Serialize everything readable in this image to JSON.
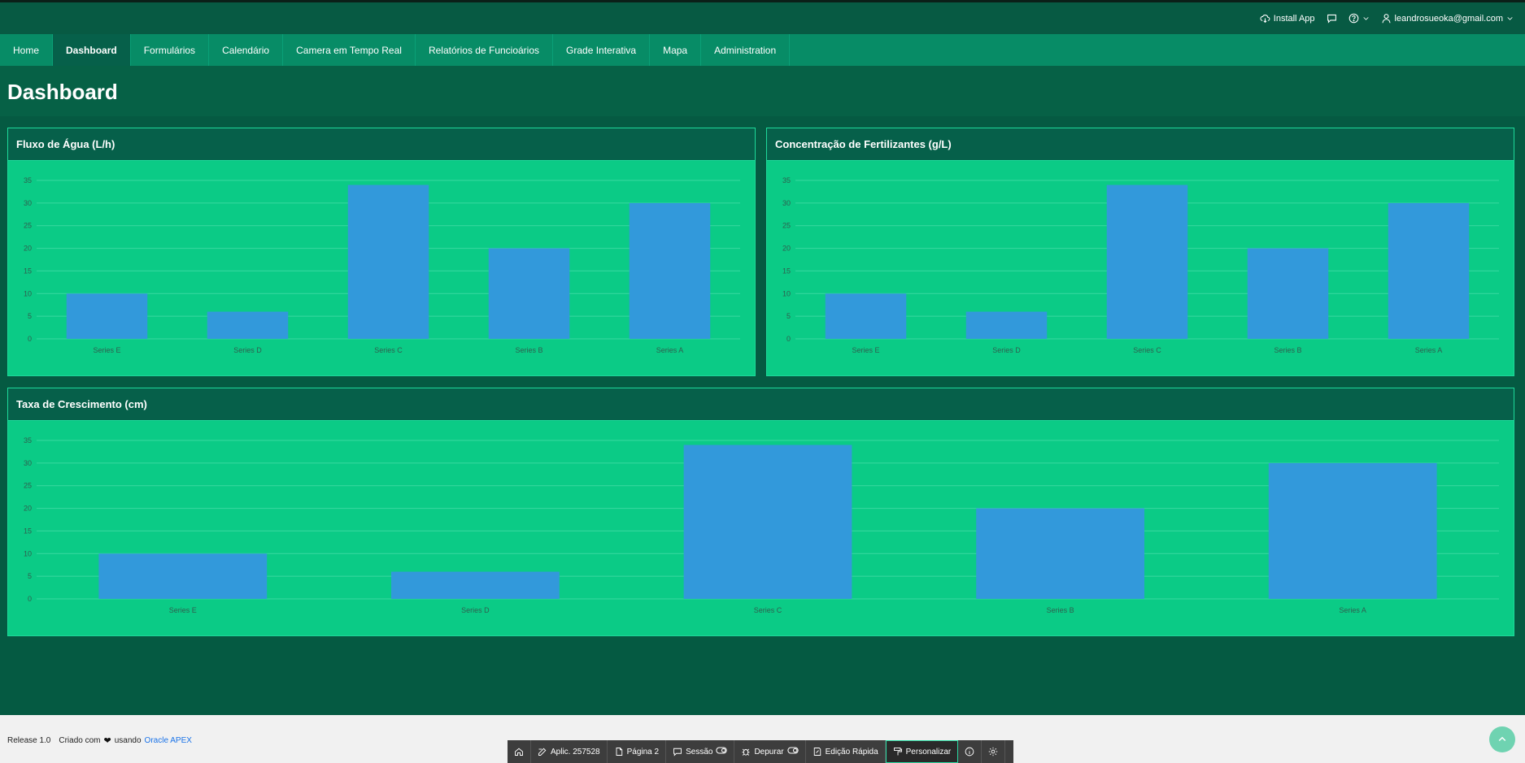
{
  "header": {
    "install_app": "Install App",
    "user_email": "leandrosueoka@gmail.com"
  },
  "nav": {
    "items": [
      {
        "label": "Home",
        "active": false
      },
      {
        "label": "Dashboard",
        "active": true
      },
      {
        "label": "Formulários",
        "active": false
      },
      {
        "label": "Calendário",
        "active": false
      },
      {
        "label": "Camera em Tempo Real",
        "active": false
      },
      {
        "label": "Relatórios de Funcioários",
        "active": false
      },
      {
        "label": "Grade Interativa",
        "active": false
      },
      {
        "label": "Mapa",
        "active": false
      },
      {
        "label": "Administration",
        "active": false
      }
    ]
  },
  "page": {
    "title": "Dashboard"
  },
  "colors": {
    "bar": "#3299db",
    "chart_bg": "#0bcb86",
    "grid": "#3ad9a0",
    "axis_text": "#2f5f4f"
  },
  "chart_data": [
    {
      "type": "bar",
      "title": "Fluxo de Água (L/h)",
      "categories": [
        "Series E",
        "Series D",
        "Series C",
        "Series B",
        "Series A"
      ],
      "values": [
        10,
        6,
        34,
        20,
        30
      ],
      "ylim": [
        0,
        35
      ],
      "yticks": [
        0,
        5,
        10,
        15,
        20,
        25,
        30,
        35
      ],
      "grid": true
    },
    {
      "type": "bar",
      "title": "Concentração de Fertilizantes (g/L)",
      "categories": [
        "Series E",
        "Series D",
        "Series C",
        "Series B",
        "Series A"
      ],
      "values": [
        10,
        6,
        34,
        20,
        30
      ],
      "ylim": [
        0,
        35
      ],
      "yticks": [
        0,
        5,
        10,
        15,
        20,
        25,
        30,
        35
      ],
      "grid": true
    },
    {
      "type": "bar",
      "title": "Taxa de Crescimento (cm)",
      "categories": [
        "Series E",
        "Series D",
        "Series C",
        "Series B",
        "Series A"
      ],
      "values": [
        10,
        6,
        34,
        20,
        30
      ],
      "ylim": [
        0,
        35
      ],
      "yticks": [
        0,
        5,
        10,
        15,
        20,
        25,
        30,
        35
      ],
      "grid": true
    }
  ],
  "footer": {
    "release": "Release 1.0",
    "made_with": "Criado com",
    "using": "usando",
    "link": "Oracle APEX"
  },
  "devbar": {
    "items": [
      {
        "label": "",
        "icon": "home-icon"
      },
      {
        "label": "Aplic. 257528",
        "icon": "edit-icon"
      },
      {
        "label": "Página 2",
        "icon": "page-icon"
      },
      {
        "label": "Sessão",
        "icon": "chat-icon"
      },
      {
        "label": "Depurar",
        "icon": "bug-icon"
      },
      {
        "label": "Edição Rápida",
        "icon": "quick-edit-icon"
      },
      {
        "label": "Personalizar",
        "icon": "paint-roller-icon"
      },
      {
        "label": "",
        "icon": "info-icon"
      },
      {
        "label": "",
        "icon": "gear-icon"
      }
    ]
  }
}
